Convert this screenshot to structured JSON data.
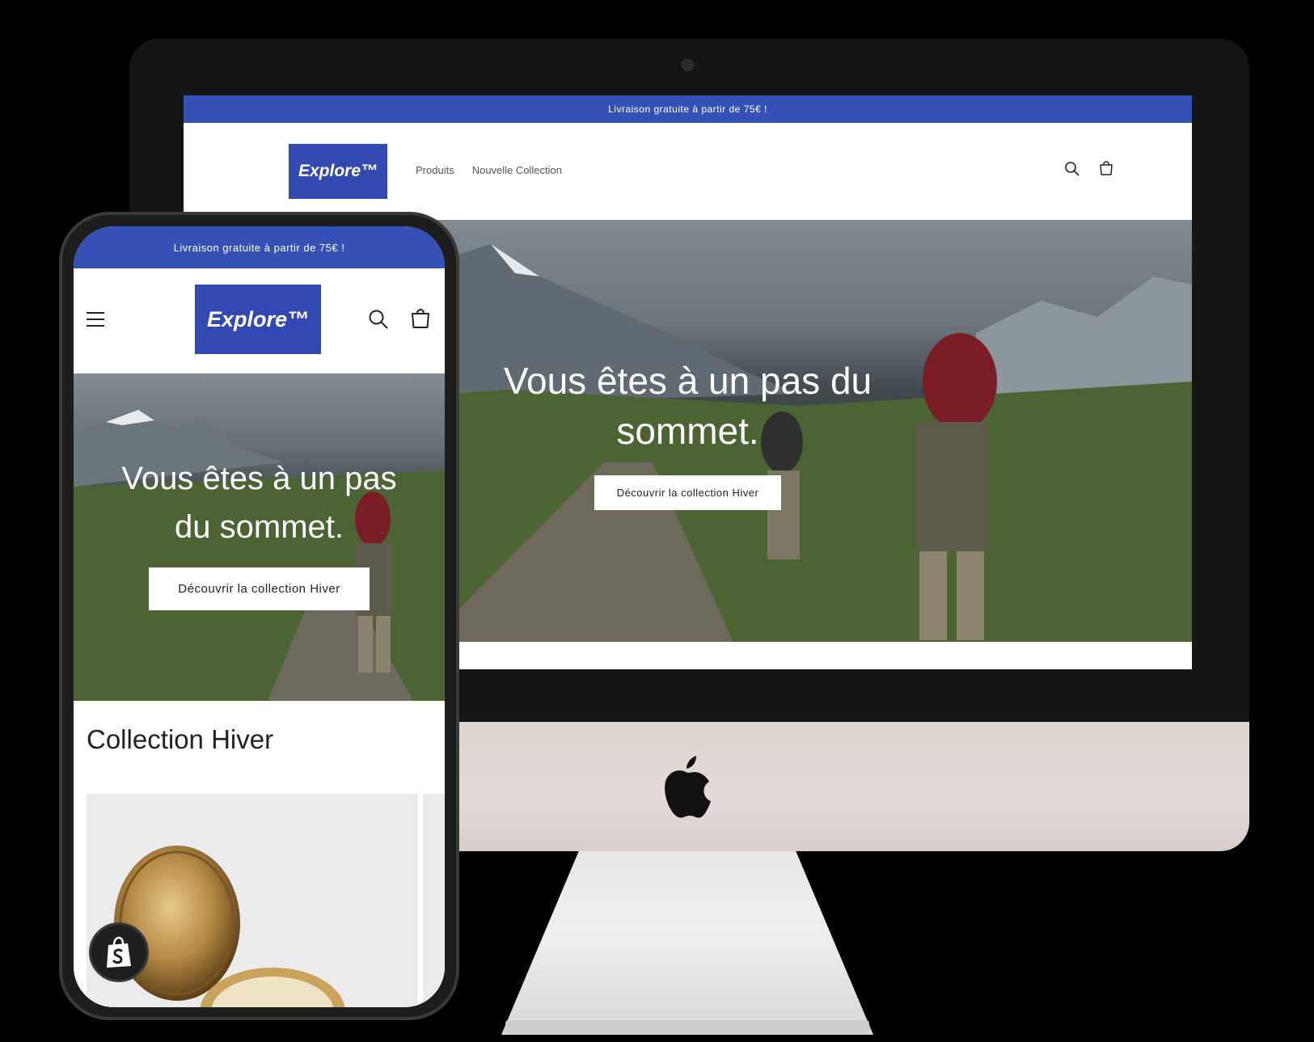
{
  "desktop": {
    "announcement": "Livraison gratuite à partir de 75€ !",
    "logo_text": "Explore™",
    "nav": [
      "Produits",
      "Nouvelle Collection"
    ],
    "hero_title_line1": "Vous êtes à un pas du",
    "hero_title_line2": "sommet.",
    "hero_cta": "Découvrir la collection Hiver"
  },
  "mobile": {
    "announcement": "Livraison gratuite à partir de 75€ !",
    "logo_text": "Explore™",
    "hero_title_line1": "Vous êtes à un pas",
    "hero_title_line2": "du sommet.",
    "hero_cta": "Découvrir la collection Hiver",
    "collection_title": "Collection Hiver"
  },
  "icons": {
    "search": "search-icon",
    "cart": "cart-icon",
    "menu": "menu-icon",
    "apple": "apple-logo",
    "shopify": "shopify-logo"
  },
  "colors": {
    "brand_blue": "#3448b2",
    "announcement_blue": "#3551b5",
    "device_frame": "#151515",
    "imac_chin": "#e0d7d4"
  }
}
